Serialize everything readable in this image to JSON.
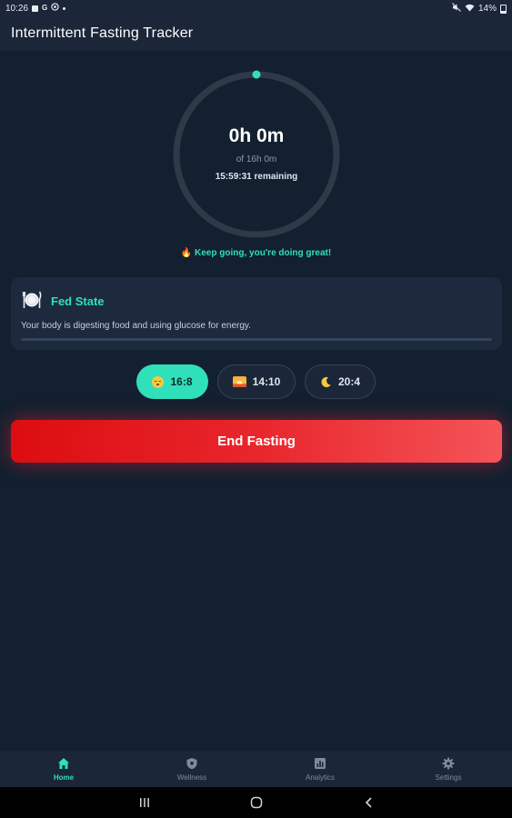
{
  "status_bar": {
    "time": "10:26",
    "battery": "14%",
    "left_icons": [
      "gallery-icon",
      "google-icon",
      "whatsapp-icon",
      "notification-dot-icon"
    ],
    "right_icons": [
      "mute-icon",
      "wifi-icon",
      "battery-icon"
    ]
  },
  "app": {
    "title": "Intermittent Fasting Tracker"
  },
  "timer": {
    "elapsed": "0h 0m",
    "goal": "of 16h 0m",
    "remaining": "15:59:31 remaining",
    "progress_fraction": 0.0
  },
  "motivation": "🔥 Keep going, you're doing great!",
  "stage": {
    "icon": "plate-icon",
    "name": "Fed State",
    "description": "Your body is digesting food and using glucose for energy.",
    "progress_fraction": 0.0
  },
  "plans": [
    {
      "label": "16:8",
      "icon": "sleepy-face-icon",
      "selected": true
    },
    {
      "label": "14:10",
      "icon": "sunrise-icon",
      "selected": false
    },
    {
      "label": "20:4",
      "icon": "crescent-moon-icon",
      "selected": false
    }
  ],
  "action": {
    "end_label": "End Fasting"
  },
  "nav": {
    "items": [
      {
        "label": "Home",
        "icon": "home-icon",
        "active": true
      },
      {
        "label": "Wellness",
        "icon": "shield-icon",
        "active": false
      },
      {
        "label": "Analytics",
        "icon": "analytics-icon",
        "active": false
      },
      {
        "label": "Settings",
        "icon": "gear-icon",
        "active": false
      }
    ]
  },
  "system_nav": [
    "recents-icon",
    "home-circle-icon",
    "back-icon"
  ],
  "colors": {
    "background": "#122030",
    "surface": "#1b2639",
    "card": "#1d2a3e",
    "accent": "#2fe0bb",
    "danger": "#e8262c",
    "text_muted": "#8e9aab"
  }
}
